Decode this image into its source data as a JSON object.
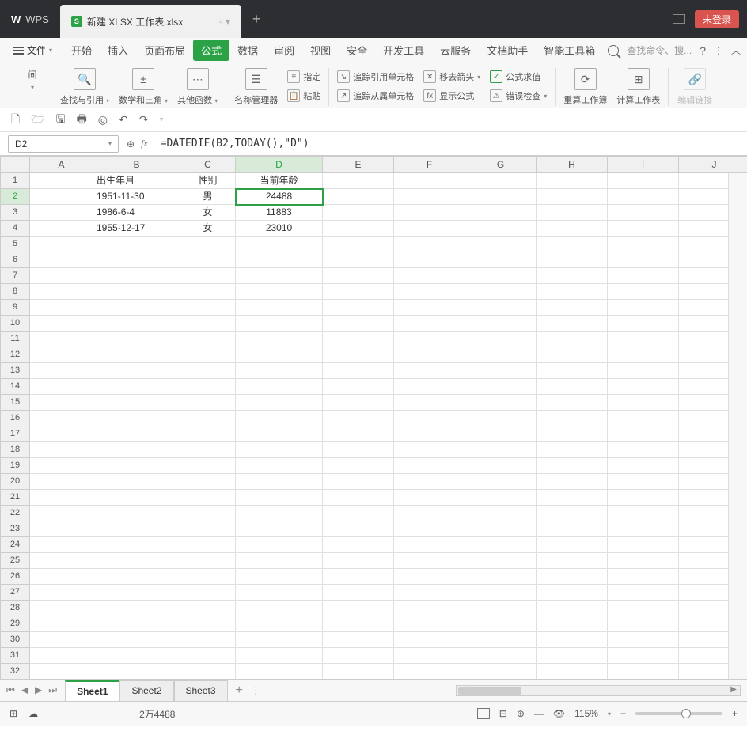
{
  "titlebar": {
    "app": "WPS",
    "file_tab": "新建 XLSX 工作表.xlsx",
    "login": "未登录"
  },
  "menu": {
    "file": "文件",
    "items": [
      "开始",
      "插入",
      "页面布局",
      "公式",
      "数据",
      "审阅",
      "视图",
      "安全",
      "开发工具",
      "云服务",
      "文档助手",
      "智能工具箱"
    ],
    "active": "公式",
    "search_placeholder": "查找命令、搜..."
  },
  "ribbon": {
    "g1a": "间",
    "g1b": "查找与引用",
    "g1c": "数学和三角",
    "g1d": "其他函数",
    "g2a": "名称管理器",
    "g2b": "指定",
    "g2c": "粘贴",
    "g3a": "追踪引用单元格",
    "g3b": "追踪从属单元格",
    "g3c": "移去箭头",
    "g3d": "显示公式",
    "g3e": "公式求值",
    "g3f": "错误检查",
    "g4a": "重算工作簿",
    "g4b": "计算工作表",
    "g5": "编辑链接"
  },
  "namebox": "D2",
  "formula": "=DATEDIF(B2,TODAY(),\"D\")",
  "fx": "fx",
  "columns": [
    "A",
    "B",
    "C",
    "D",
    "E",
    "F",
    "G",
    "H",
    "I",
    "J"
  ],
  "rows_count": 32,
  "active_col_index": 3,
  "active_row": 2,
  "cells": {
    "B1": "出生年月",
    "C1": "性别",
    "D1": "当前年龄",
    "B2": "1951-11-30",
    "C2": "男",
    "D2": "24488",
    "B3": "1986-6-4",
    "C3": "女",
    "D3": "11883",
    "B4": "1955-12-17",
    "C4": "女",
    "D4": "23010"
  },
  "sheettabs": [
    "Sheet1",
    "Sheet2",
    "Sheet3"
  ],
  "active_sheet": 0,
  "status": {
    "count": "2万4488",
    "zoom": "115%"
  }
}
